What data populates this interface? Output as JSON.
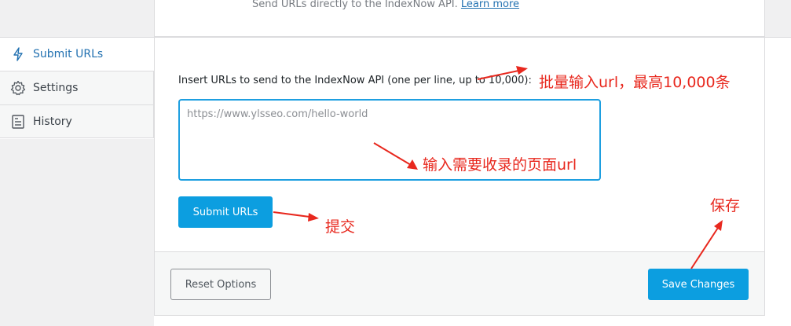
{
  "header": {
    "description": "Send URLs directly to the IndexNow API.",
    "learn_more": "Learn more"
  },
  "sidebar": {
    "items": [
      {
        "label": "Submit URLs",
        "icon": "lightning-icon",
        "active": true
      },
      {
        "label": "Settings",
        "icon": "gear-icon",
        "active": false
      },
      {
        "label": "History",
        "icon": "document-list-icon",
        "active": false
      }
    ]
  },
  "main": {
    "field_label": "Insert URLs to send to the IndexNow API (one per line, up to 10,000):",
    "textarea_placeholder": "https://www.ylsseo.com/hello-world",
    "submit_label": "Submit URLs"
  },
  "footer": {
    "reset_label": "Reset Options",
    "save_label": "Save Changes"
  },
  "annotations": {
    "bulk_input": "批量输入url，最高10,000条",
    "page_url": "输入需要收录的页面url",
    "submit": "提交",
    "save": "保存"
  },
  "colors": {
    "accent": "#0c9ee0",
    "link": "#2271b1",
    "annotation": "#e8281e",
    "textarea_border": "#1e9fe0"
  }
}
